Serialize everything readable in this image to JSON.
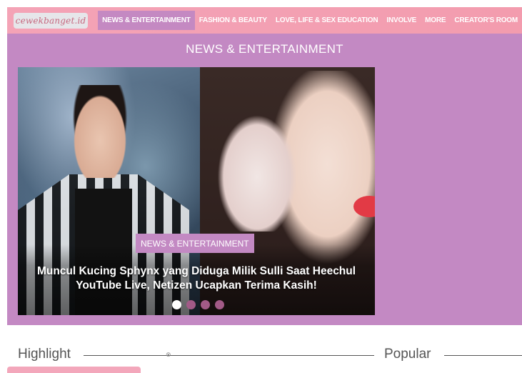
{
  "header": {
    "logo_text": "cewekbanget.id",
    "nav": [
      {
        "label": "NEWS & ENTERTAINMENT",
        "active": true
      },
      {
        "label": "FASHION & BEAUTY",
        "active": false
      },
      {
        "label": "LOVE, LIFE & SEX EDUCATION",
        "active": false
      },
      {
        "label": "INVOLVE",
        "active": false
      },
      {
        "label": "MORE",
        "active": false
      },
      {
        "label": "CREATOR'S ROOM",
        "active": false
      }
    ]
  },
  "section": {
    "title": "NEWS & ENTERTAINMENT"
  },
  "slider": {
    "category": "NEWS & ENTERTAINMENT",
    "title": "Muncul Kucing Sphynx yang Diduga Milik Sulli Saat Heechul YouTube Live, Netizen Ucapkan Terima Kasih!",
    "dots": 4,
    "active_dot": 0
  },
  "bottom": {
    "highlight_label": "Highlight",
    "popular_label": "Popular"
  },
  "colors": {
    "topbar": "#f4a3b6",
    "band": "#c389c3",
    "dot": "#a25a87"
  }
}
